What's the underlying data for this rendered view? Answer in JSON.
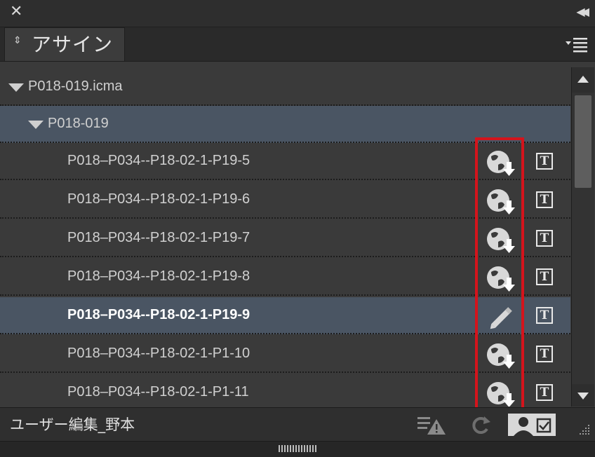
{
  "window": {
    "close_glyph": "✕",
    "collapse_glyph": "◀◀"
  },
  "tab": {
    "label": "アサイン",
    "updown_glyph": "⇕"
  },
  "list": {
    "root": {
      "label": "P018-019.icma",
      "expanded": true
    },
    "group": {
      "label": "P018-019",
      "expanded": true
    },
    "items": [
      {
        "label": "P018–P034--P18-02-1-P19-5",
        "status_icon": "globe-download-icon",
        "type_icon": "text-frame-icon"
      },
      {
        "label": "P018–P034--P18-02-1-P19-6",
        "status_icon": "globe-download-icon",
        "type_icon": "text-frame-icon"
      },
      {
        "label": "P018–P034--P18-02-1-P19-7",
        "status_icon": "globe-download-icon",
        "type_icon": "text-frame-icon"
      },
      {
        "label": "P018–P034--P18-02-1-P19-8",
        "status_icon": "globe-download-icon",
        "type_icon": "text-frame-icon"
      },
      {
        "label": "P018–P034--P18-02-1-P19-9",
        "status_icon": "pencil-icon",
        "type_icon": "text-frame-icon",
        "selected": true
      },
      {
        "label": "P018–P034--P18-02-1-P1-10",
        "status_icon": "globe-download-icon",
        "type_icon": "text-frame-icon"
      },
      {
        "label": "P018–P034--P18-02-1-P1-11",
        "status_icon": "globe-download-icon",
        "type_icon": "text-frame-icon"
      }
    ],
    "type_icon_glyph": "T"
  },
  "footer": {
    "user_label": "ユーザー編集_野本"
  },
  "colors": {
    "highlight_box": "#d4141c",
    "selected_band": "#4a5563"
  }
}
